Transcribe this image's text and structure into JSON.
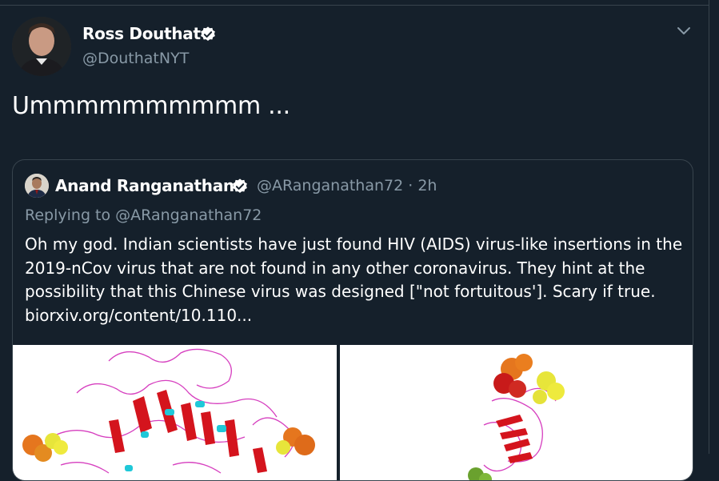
{
  "tweet": {
    "author_name": "Ross Douthat",
    "author_handle": "@DouthatNYT",
    "text": "Ummmmmmmmmm ...",
    "menu_icon": "chevron-down-icon",
    "verified_icon": "verified-badge-icon"
  },
  "quoted": {
    "author_name": "Anand Ranganathan",
    "author_handle": "@ARanganathan72",
    "separator": " · ",
    "time": "2h",
    "replying_prefix": "Replying to ",
    "replying_handle": "@ARanganathan72",
    "body_lines": [
      "Oh my god. Indian scientists have just found HIV (AIDS) virus-like insertions in the",
      "2019-nCov virus that are not found in any other coronavirus. They hint at the",
      "possibility that this Chinese virus was designed [\"not fortuitous']. Scary if true.",
      "biorxiv.org/content/10.110..."
    ]
  },
  "colors": {
    "background": "#15202b",
    "border": "#38444d",
    "secondary_text": "#8899a6",
    "verified_blue": "#1da1f2"
  }
}
